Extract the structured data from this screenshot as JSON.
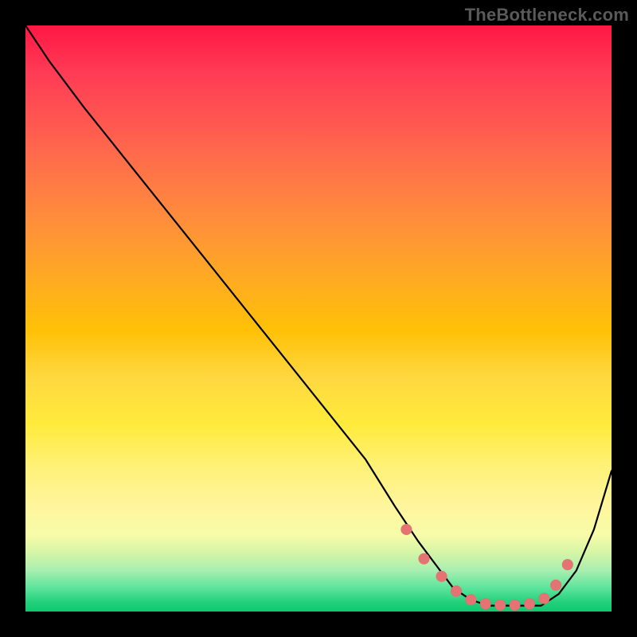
{
  "attribution": "TheBottleneck.com",
  "colors": {
    "page_bg": "#000000",
    "curve": "#000000",
    "marker": "#e57373",
    "gradient_top": "#ff1744",
    "gradient_bottom": "#0ec96f"
  },
  "chart_data": {
    "type": "line",
    "title": "",
    "xlabel": "",
    "ylabel": "",
    "xlim": [
      0,
      100
    ],
    "ylim": [
      0,
      100
    ],
    "grid": false,
    "series": [
      {
        "name": "bottleneck-curve",
        "x": [
          0,
          4,
          10,
          18,
          26,
          34,
          42,
          50,
          58,
          63,
          67,
          70,
          73,
          76,
          79,
          82,
          85,
          88,
          91,
          94,
          97,
          100
        ],
        "y": [
          100,
          94,
          86,
          76,
          66,
          56,
          46,
          36,
          26,
          18,
          12,
          8,
          4,
          2,
          1,
          1,
          1,
          1,
          3,
          7,
          14,
          24
        ]
      }
    ],
    "markers": {
      "name": "highlight-dots",
      "x": [
        65,
        68,
        71,
        73.5,
        76,
        78.5,
        81,
        83.5,
        86,
        88.5,
        90.5,
        92.5
      ],
      "y": [
        14,
        9,
        6,
        3.5,
        2,
        1.3,
        1.1,
        1.1,
        1.3,
        2.2,
        4.5,
        8
      ]
    }
  }
}
